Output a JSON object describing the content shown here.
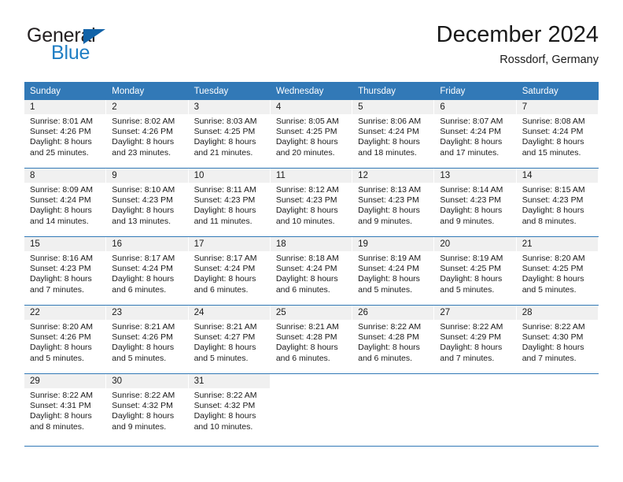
{
  "brand": {
    "name_part1": "General",
    "name_part2": "Blue",
    "triangle_color": "#1263a8",
    "blue_color": "#1f7ec4"
  },
  "header": {
    "title": "December 2024",
    "subtitle": "Rossdorf, Germany"
  },
  "theme": {
    "header_blue": "#3279b7",
    "daynum_bg": "#f0f0f0",
    "text": "#1a1a1a"
  },
  "weekdays": [
    "Sunday",
    "Monday",
    "Tuesday",
    "Wednesday",
    "Thursday",
    "Friday",
    "Saturday"
  ],
  "weeks": [
    [
      {
        "day": "1",
        "sunrise": "Sunrise: 8:01 AM",
        "sunset": "Sunset: 4:26 PM",
        "daylight1": "Daylight: 8 hours",
        "daylight2": "and 25 minutes."
      },
      {
        "day": "2",
        "sunrise": "Sunrise: 8:02 AM",
        "sunset": "Sunset: 4:26 PM",
        "daylight1": "Daylight: 8 hours",
        "daylight2": "and 23 minutes."
      },
      {
        "day": "3",
        "sunrise": "Sunrise: 8:03 AM",
        "sunset": "Sunset: 4:25 PM",
        "daylight1": "Daylight: 8 hours",
        "daylight2": "and 21 minutes."
      },
      {
        "day": "4",
        "sunrise": "Sunrise: 8:05 AM",
        "sunset": "Sunset: 4:25 PM",
        "daylight1": "Daylight: 8 hours",
        "daylight2": "and 20 minutes."
      },
      {
        "day": "5",
        "sunrise": "Sunrise: 8:06 AM",
        "sunset": "Sunset: 4:24 PM",
        "daylight1": "Daylight: 8 hours",
        "daylight2": "and 18 minutes."
      },
      {
        "day": "6",
        "sunrise": "Sunrise: 8:07 AM",
        "sunset": "Sunset: 4:24 PM",
        "daylight1": "Daylight: 8 hours",
        "daylight2": "and 17 minutes."
      },
      {
        "day": "7",
        "sunrise": "Sunrise: 8:08 AM",
        "sunset": "Sunset: 4:24 PM",
        "daylight1": "Daylight: 8 hours",
        "daylight2": "and 15 minutes."
      }
    ],
    [
      {
        "day": "8",
        "sunrise": "Sunrise: 8:09 AM",
        "sunset": "Sunset: 4:24 PM",
        "daylight1": "Daylight: 8 hours",
        "daylight2": "and 14 minutes."
      },
      {
        "day": "9",
        "sunrise": "Sunrise: 8:10 AM",
        "sunset": "Sunset: 4:23 PM",
        "daylight1": "Daylight: 8 hours",
        "daylight2": "and 13 minutes."
      },
      {
        "day": "10",
        "sunrise": "Sunrise: 8:11 AM",
        "sunset": "Sunset: 4:23 PM",
        "daylight1": "Daylight: 8 hours",
        "daylight2": "and 11 minutes."
      },
      {
        "day": "11",
        "sunrise": "Sunrise: 8:12 AM",
        "sunset": "Sunset: 4:23 PM",
        "daylight1": "Daylight: 8 hours",
        "daylight2": "and 10 minutes."
      },
      {
        "day": "12",
        "sunrise": "Sunrise: 8:13 AM",
        "sunset": "Sunset: 4:23 PM",
        "daylight1": "Daylight: 8 hours",
        "daylight2": "and 9 minutes."
      },
      {
        "day": "13",
        "sunrise": "Sunrise: 8:14 AM",
        "sunset": "Sunset: 4:23 PM",
        "daylight1": "Daylight: 8 hours",
        "daylight2": "and 9 minutes."
      },
      {
        "day": "14",
        "sunrise": "Sunrise: 8:15 AM",
        "sunset": "Sunset: 4:23 PM",
        "daylight1": "Daylight: 8 hours",
        "daylight2": "and 8 minutes."
      }
    ],
    [
      {
        "day": "15",
        "sunrise": "Sunrise: 8:16 AM",
        "sunset": "Sunset: 4:23 PM",
        "daylight1": "Daylight: 8 hours",
        "daylight2": "and 7 minutes."
      },
      {
        "day": "16",
        "sunrise": "Sunrise: 8:17 AM",
        "sunset": "Sunset: 4:24 PM",
        "daylight1": "Daylight: 8 hours",
        "daylight2": "and 6 minutes."
      },
      {
        "day": "17",
        "sunrise": "Sunrise: 8:17 AM",
        "sunset": "Sunset: 4:24 PM",
        "daylight1": "Daylight: 8 hours",
        "daylight2": "and 6 minutes."
      },
      {
        "day": "18",
        "sunrise": "Sunrise: 8:18 AM",
        "sunset": "Sunset: 4:24 PM",
        "daylight1": "Daylight: 8 hours",
        "daylight2": "and 6 minutes."
      },
      {
        "day": "19",
        "sunrise": "Sunrise: 8:19 AM",
        "sunset": "Sunset: 4:24 PM",
        "daylight1": "Daylight: 8 hours",
        "daylight2": "and 5 minutes."
      },
      {
        "day": "20",
        "sunrise": "Sunrise: 8:19 AM",
        "sunset": "Sunset: 4:25 PM",
        "daylight1": "Daylight: 8 hours",
        "daylight2": "and 5 minutes."
      },
      {
        "day": "21",
        "sunrise": "Sunrise: 8:20 AM",
        "sunset": "Sunset: 4:25 PM",
        "daylight1": "Daylight: 8 hours",
        "daylight2": "and 5 minutes."
      }
    ],
    [
      {
        "day": "22",
        "sunrise": "Sunrise: 8:20 AM",
        "sunset": "Sunset: 4:26 PM",
        "daylight1": "Daylight: 8 hours",
        "daylight2": "and 5 minutes."
      },
      {
        "day": "23",
        "sunrise": "Sunrise: 8:21 AM",
        "sunset": "Sunset: 4:26 PM",
        "daylight1": "Daylight: 8 hours",
        "daylight2": "and 5 minutes."
      },
      {
        "day": "24",
        "sunrise": "Sunrise: 8:21 AM",
        "sunset": "Sunset: 4:27 PM",
        "daylight1": "Daylight: 8 hours",
        "daylight2": "and 5 minutes."
      },
      {
        "day": "25",
        "sunrise": "Sunrise: 8:21 AM",
        "sunset": "Sunset: 4:28 PM",
        "daylight1": "Daylight: 8 hours",
        "daylight2": "and 6 minutes."
      },
      {
        "day": "26",
        "sunrise": "Sunrise: 8:22 AM",
        "sunset": "Sunset: 4:28 PM",
        "daylight1": "Daylight: 8 hours",
        "daylight2": "and 6 minutes."
      },
      {
        "day": "27",
        "sunrise": "Sunrise: 8:22 AM",
        "sunset": "Sunset: 4:29 PM",
        "daylight1": "Daylight: 8 hours",
        "daylight2": "and 7 minutes."
      },
      {
        "day": "28",
        "sunrise": "Sunrise: 8:22 AM",
        "sunset": "Sunset: 4:30 PM",
        "daylight1": "Daylight: 8 hours",
        "daylight2": "and 7 minutes."
      }
    ],
    [
      {
        "day": "29",
        "sunrise": "Sunrise: 8:22 AM",
        "sunset": "Sunset: 4:31 PM",
        "daylight1": "Daylight: 8 hours",
        "daylight2": "and 8 minutes."
      },
      {
        "day": "30",
        "sunrise": "Sunrise: 8:22 AM",
        "sunset": "Sunset: 4:32 PM",
        "daylight1": "Daylight: 8 hours",
        "daylight2": "and 9 minutes."
      },
      {
        "day": "31",
        "sunrise": "Sunrise: 8:22 AM",
        "sunset": "Sunset: 4:32 PM",
        "daylight1": "Daylight: 8 hours",
        "daylight2": "and 10 minutes."
      },
      {
        "day": "",
        "sunrise": "",
        "sunset": "",
        "daylight1": "",
        "daylight2": ""
      },
      {
        "day": "",
        "sunrise": "",
        "sunset": "",
        "daylight1": "",
        "daylight2": ""
      },
      {
        "day": "",
        "sunrise": "",
        "sunset": "",
        "daylight1": "",
        "daylight2": ""
      },
      {
        "day": "",
        "sunrise": "",
        "sunset": "",
        "daylight1": "",
        "daylight2": ""
      }
    ]
  ]
}
